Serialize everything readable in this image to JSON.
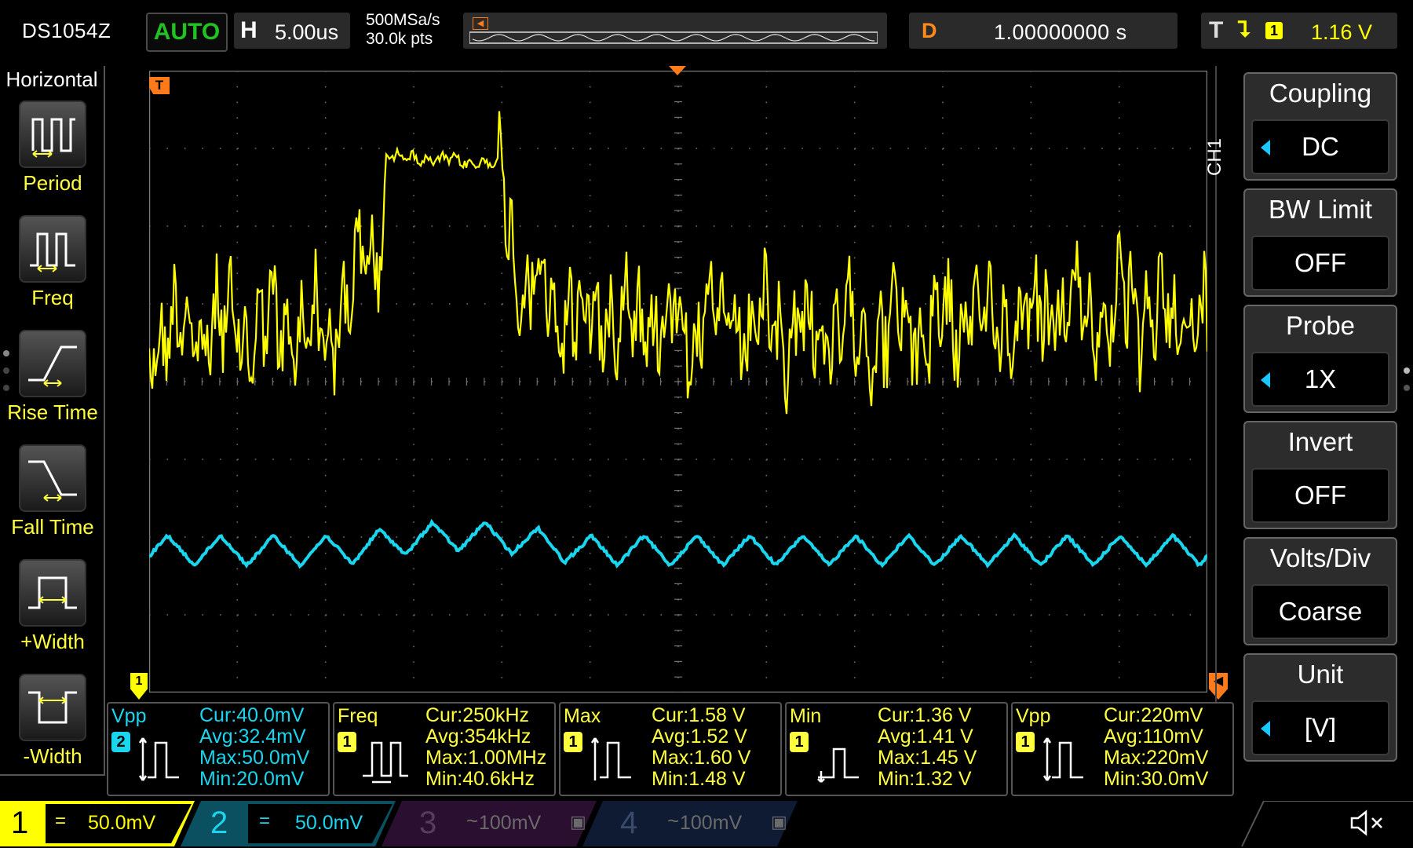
{
  "top": {
    "model": "DS1054Z",
    "run_state": "AUTO",
    "timebase_label": "H",
    "timebase_value": "5.00us",
    "sample_rate": "500MSa/s",
    "memory_depth": "30.0k pts",
    "delay_label": "D",
    "delay_value": "1.00000000 s",
    "trigger_label": "T",
    "trigger_source": "1",
    "trigger_level": "1.16 V"
  },
  "grid_markers": {
    "trigger_marker": "T",
    "ch1_marker": "1"
  },
  "left_panel": {
    "title": "Horizontal",
    "items": [
      {
        "label": "Period",
        "icon": "period-icon"
      },
      {
        "label": "Freq",
        "icon": "frequency-icon"
      },
      {
        "label": "Rise Time",
        "icon": "rise-time-icon"
      },
      {
        "label": "Fall Time",
        "icon": "fall-time-icon"
      },
      {
        "label": "+Width",
        "icon": "positive-width-icon"
      },
      {
        "label": "-Width",
        "icon": "negative-width-icon"
      }
    ]
  },
  "right_panel": {
    "channel": "CH1",
    "items": [
      {
        "title": "Coupling",
        "value": "DC",
        "arrow": true
      },
      {
        "title": "BW Limit",
        "value": "OFF",
        "arrow": false
      },
      {
        "title": "Probe",
        "value": "1X",
        "arrow": true
      },
      {
        "title": "Invert",
        "value": "OFF",
        "arrow": false
      },
      {
        "title": "Volts/Div",
        "value": "Coarse",
        "arrow": false
      },
      {
        "title": "Unit",
        "value": "[V]",
        "arrow": true
      }
    ]
  },
  "measurements": [
    {
      "name": "Vpp",
      "source": "2",
      "color": "#19d6ee",
      "cur": "Cur:40.0mV",
      "avg": "Avg:32.4mV",
      "max": "Max:50.0mV",
      "min": "Min:20.0mV"
    },
    {
      "name": "Freq",
      "source": "1",
      "color": "#ffff40",
      "cur": "Cur:250kHz",
      "avg": "Avg:354kHz",
      "max": "Max:1.00MHz",
      "min": "Min:40.6kHz"
    },
    {
      "name": "Max",
      "source": "1",
      "color": "#ffff40",
      "cur": "Cur:1.58 V",
      "avg": "Avg:1.52 V",
      "max": "Max:1.60 V",
      "min": "Min:1.48 V"
    },
    {
      "name": "Min",
      "source": "1",
      "color": "#ffff40",
      "cur": "Cur:1.36 V",
      "avg": "Avg:1.41 V",
      "max": "Max:1.45 V",
      "min": "Min:1.32 V"
    },
    {
      "name": "Vpp",
      "source": "1",
      "color": "#ffff40",
      "cur": "Cur:220mV",
      "avg": "Avg:110mV",
      "max": "Max:220mV",
      "min": "Min:30.0mV"
    }
  ],
  "channels": [
    {
      "num": "1",
      "coupling": "=",
      "scale": "50.0mV",
      "color": "#ffff00",
      "active": true
    },
    {
      "num": "2",
      "coupling": "=",
      "scale": "50.0mV",
      "color": "#19d6ee",
      "active": true
    },
    {
      "num": "3",
      "coupling": "~",
      "scale": "100mV",
      "color": "#b040c0",
      "active": false
    },
    {
      "num": "4",
      "coupling": "~",
      "scale": "100mV",
      "color": "#3a6fd8",
      "active": false
    }
  ],
  "colors": {
    "ch1": "#ffff00",
    "ch2": "#19d6ee",
    "trigger": "#ff7a1a",
    "run_state": "#21c321"
  }
}
